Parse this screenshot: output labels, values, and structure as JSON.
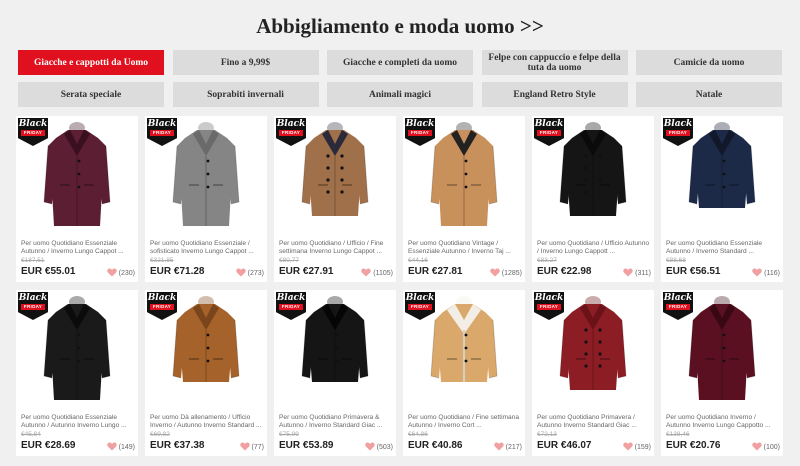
{
  "page": {
    "title": "Abbigliamento e moda uomo >>"
  },
  "tabs": [
    {
      "label": "Giacche e cappotti da Uomo",
      "active": true
    },
    {
      "label": "Fino a 9,99$",
      "active": false
    },
    {
      "label": "Giacche e completi da uomo",
      "active": false
    },
    {
      "label": "Felpe con cappuccio e felpe della tuta da uomo",
      "active": false
    },
    {
      "label": "Camicie da uomo",
      "active": false
    },
    {
      "label": "Serata speciale",
      "active": false
    },
    {
      "label": "Soprabiti invernali",
      "active": false
    },
    {
      "label": "Animali magici",
      "active": false
    },
    {
      "label": "England Retro Style",
      "active": false
    },
    {
      "label": "Natale",
      "active": false
    }
  ],
  "badge": {
    "line1": "Black",
    "line2": "FRIDAY"
  },
  "colors": {
    "accent": "#e0101e",
    "heart": "#f0a0a0"
  },
  "products": [
    {
      "desc": "Per uomo Quotidiano Essenziale Autunno / Inverno Lungo Cappot ...",
      "old_price": "€187,51",
      "price": "EUR €55.01",
      "likes": "(230)",
      "coat_color": "#5c1e33",
      "collar": "#3a1020",
      "style": "long"
    },
    {
      "desc": "Per uomo Quotidiano Essenziale / sofisticato Inverno Lungo Cappot ...",
      "old_price": "€321,85",
      "price": "EUR €71.28",
      "likes": "(273)",
      "coat_color": "#858585",
      "collar": "#6a6a6a",
      "style": "long"
    },
    {
      "desc": "Per uomo Quotidiano / Ufficio / Fine settimana Inverno Lungo Cappot ...",
      "old_price": "€80,77",
      "price": "EUR €27.91",
      "likes": "(1105)",
      "coat_color": "#a0704a",
      "collar": "#2a2a3a",
      "style": "double"
    },
    {
      "desc": "Per uomo Quotidiano Vintage / Essenziale Autunno / Inverno Taj ...",
      "old_price": "€44,16",
      "price": "EUR €27.81",
      "likes": "(1285)",
      "coat_color": "#c8915c",
      "collar": "#222",
      "style": "long"
    },
    {
      "desc": "Per uomo Quotidiano / Ufficio Autunno / Inverno Lungo Cappott ...",
      "old_price": "€83,27",
      "price": "EUR €22.98",
      "likes": "(311)",
      "coat_color": "#151515",
      "collar": "#0a0a0a",
      "style": "double"
    },
    {
      "desc": "Per uomo Quotidiano Essenziale Autunno / Inverno Standard ...",
      "old_price": "€88,68",
      "price": "EUR €56.51",
      "likes": "(116)",
      "coat_color": "#1c2a48",
      "collar": "#10182a",
      "style": "short"
    },
    {
      "desc": "Per uomo Quotidiano Essenziale Autunno / Autunno Inverno Lungo ...",
      "old_price": "€45,84",
      "price": "EUR €28.69",
      "likes": "(149)",
      "coat_color": "#1a1a1a",
      "collar": "#0b0b0b",
      "style": "long"
    },
    {
      "desc": "Per uomo Dà allenamento / Ufficio Inverno / Autunno Inverno Standard ...",
      "old_price": "€69,82",
      "price": "EUR €37.38",
      "likes": "(77)",
      "coat_color": "#a5622a",
      "collar": "#7a451a",
      "style": "short"
    },
    {
      "desc": "Per uomo Quotidiano Primavera & Autunno / Inverno Standard Giac ...",
      "old_price": "€75,99",
      "price": "EUR €53.89",
      "likes": "(503)",
      "coat_color": "#151515",
      "collar": "#050505",
      "style": "short"
    },
    {
      "desc": "Per uomo Quotidiano / Fine settimana Autunno / Inverno Cort ...",
      "old_price": "€64,86",
      "price": "EUR €40.86",
      "likes": "(217)",
      "coat_color": "#d9a86a",
      "collar": "#f2eee6",
      "style": "shearling"
    },
    {
      "desc": "Per uomo Quotidiano Primavera / Autunno Inverno Standard Giac ...",
      "old_price": "€72,13",
      "price": "EUR €46.07",
      "likes": "(159)",
      "coat_color": "#8c1d24",
      "collar": "#6a1218",
      "style": "double"
    },
    {
      "desc": "Per uomo Quotidiano Inverno / Autunno Inverno Lungo Cappotto ...",
      "old_price": "€138,46",
      "price": "EUR €20.76",
      "likes": "(100)",
      "coat_color": "#5a1020",
      "collar": "#3a0812",
      "style": "long"
    }
  ]
}
